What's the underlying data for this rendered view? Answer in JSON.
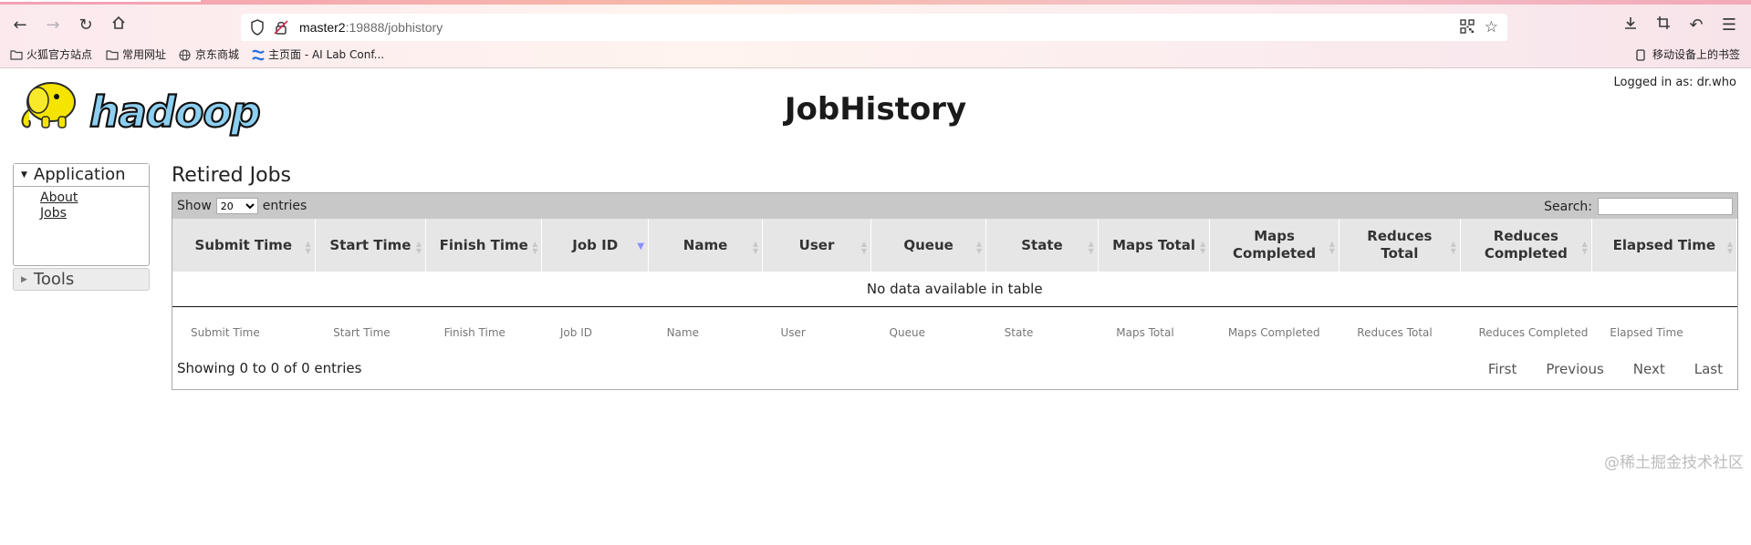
{
  "browser": {
    "url_host": "master2",
    "url_rest": ":19888/jobhistory",
    "bookmarks": [
      "火狐官方站点",
      "常用网址",
      "京东商城",
      "主页面 - AI Lab Conf..."
    ],
    "mobile_bookmarks": "移动设备上的书签"
  },
  "header": {
    "title": "JobHistory",
    "logged_in": "Logged in as: dr.who",
    "logo_text": "hadoop"
  },
  "nav": {
    "application_label": "Application",
    "items": [
      "About",
      "Jobs"
    ],
    "tools_label": "Tools"
  },
  "main": {
    "heading": "Retired Jobs",
    "show_label": "Show",
    "entries_label": "entries",
    "page_size": "20",
    "search_label": "Search:",
    "columns": [
      "Submit Time",
      "Start Time",
      "Finish Time",
      "Job ID",
      "Name",
      "User",
      "Queue",
      "State",
      "Maps Total",
      "Maps Completed",
      "Reduces Total",
      "Reduces Completed",
      "Elapsed Time"
    ],
    "empty_message": "No data available in table",
    "footer_columns": [
      "Submit Time",
      "Start Time",
      "Finish Time",
      "Job ID",
      "Name",
      "User",
      "Queue",
      "State",
      "Maps Total",
      "Maps Completed",
      "Reduces Total",
      "Reduces Completed",
      "Elapsed Time"
    ],
    "info": "Showing 0 to 0 of 0 entries",
    "pager": [
      "First",
      "Previous",
      "Next",
      "Last"
    ]
  },
  "watermark": "@稀土掘金技术社区"
}
